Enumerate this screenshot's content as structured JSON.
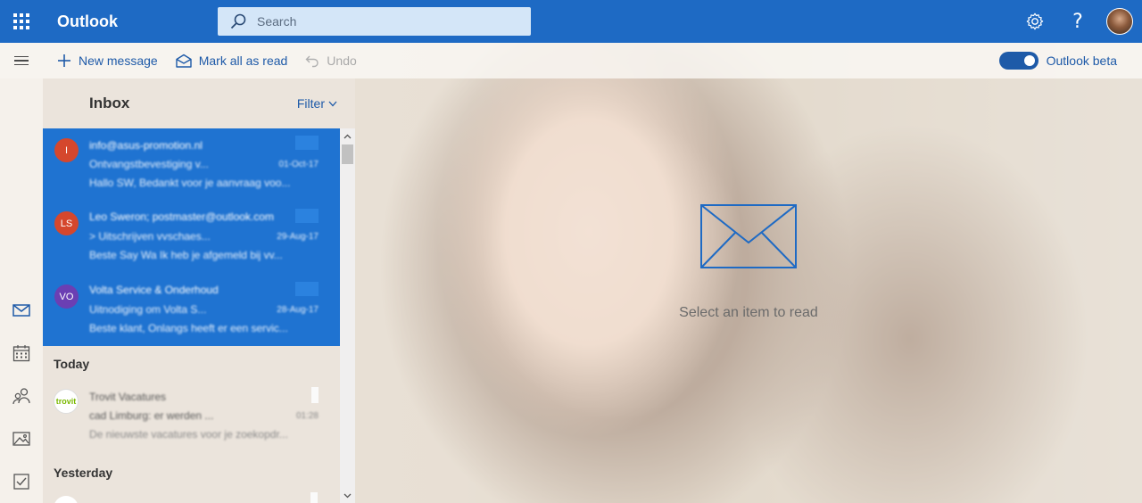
{
  "app": {
    "name": "Outlook"
  },
  "search": {
    "placeholder": "Search"
  },
  "colors": {
    "suite_bar": "#1e6ac4",
    "accent": "#1e5aa8",
    "selected_row": "#1f73d1"
  },
  "commands": {
    "new_message": "New message",
    "mark_all_read": "Mark all as read",
    "undo": "Undo",
    "beta_label": "Outlook beta",
    "beta_on": true
  },
  "rail": {
    "items": [
      {
        "icon": "mail-icon",
        "active": true
      },
      {
        "icon": "calendar-icon",
        "active": false
      },
      {
        "icon": "people-icon",
        "active": false
      },
      {
        "icon": "photos-icon",
        "active": false
      },
      {
        "icon": "tasks-icon",
        "active": false
      }
    ]
  },
  "list": {
    "title": "Inbox",
    "filter_label": "Filter",
    "selected_messages": [
      {
        "initials": "I",
        "avatar_color": "#d5472d",
        "sender": "info@asus-promotion.nl",
        "subject": "Ontvangstbevestiging v...",
        "date": "01-Oct-17",
        "preview": "Hallo SW, Bedankt voor je aanvraag voo..."
      },
      {
        "initials": "LS",
        "avatar_color": "#d5472d",
        "sender": "Leo Sweron; postmaster@outlook.com",
        "subject": "> Uitschrijven vvschaes...",
        "date": "29-Aug-17",
        "preview": "Beste Say Wa Ik heb je afgemeld bij vv..."
      },
      {
        "initials": "VO",
        "avatar_color": "#6b3fb3",
        "sender": "Volta Service & Onderhoud",
        "subject": "Uitnodiging om Volta S...",
        "date": "28-Aug-17",
        "preview": "Beste klant, Onlangs heeft er een servic..."
      }
    ],
    "sections": [
      {
        "label": "Today",
        "messages": [
          {
            "initials": "trovit",
            "sender": "Trovit Vacatures",
            "subject": "cad Limburg: er werden ...",
            "date": "01:28",
            "preview": "De nieuwste vacatures voor je zoekopdr..."
          }
        ]
      },
      {
        "label": "Yesterday",
        "messages": []
      }
    ]
  },
  "reading_pane": {
    "empty_text": "Select an item to read"
  }
}
